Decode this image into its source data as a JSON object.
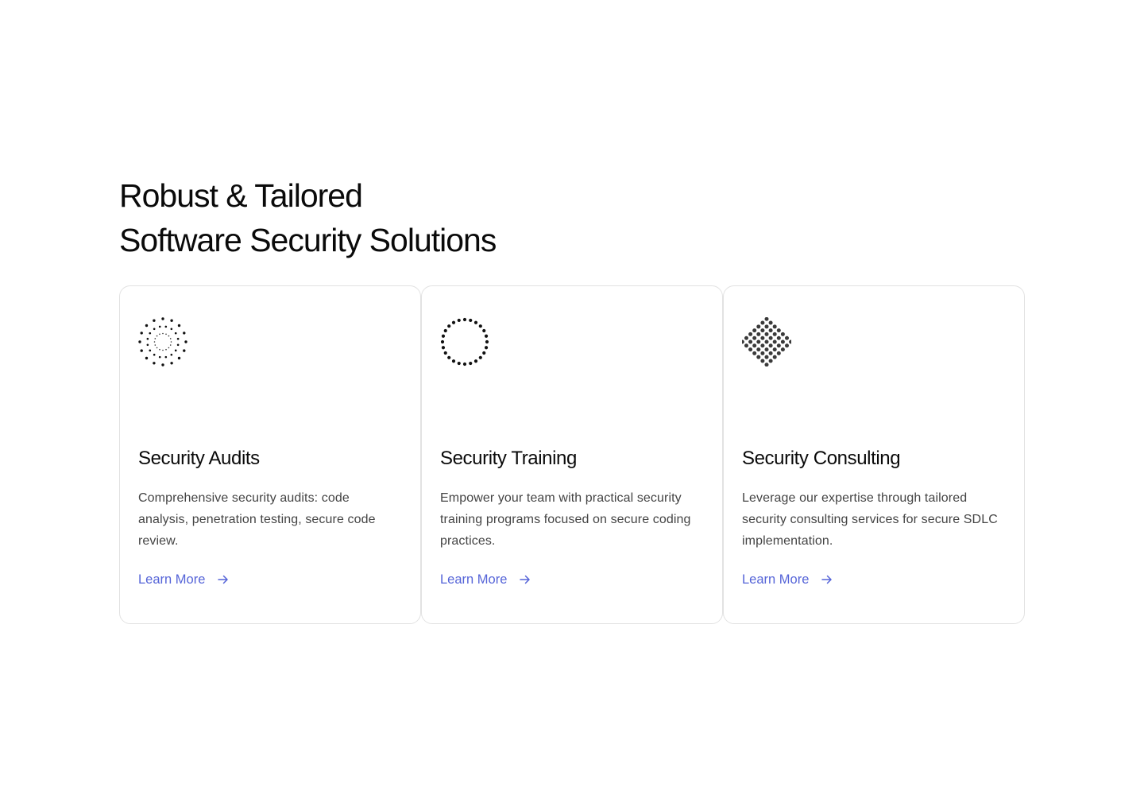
{
  "section": {
    "heading_line1": "Robust & Tailored",
    "heading_line2": "Software Security Solutions"
  },
  "cards": [
    {
      "title": "Security Audits",
      "description": "Comprehensive security audits: code analysis, penetration testing, secure code review.",
      "link_label": "Learn More",
      "icon": "dotted-rings-icon"
    },
    {
      "title": "Security Training",
      "description": "Empower your team with practical security training programs focused on secure coding practices.",
      "link_label": "Learn More",
      "icon": "dotted-circle-icon"
    },
    {
      "title": "Security Consulting",
      "description": "Leverage our expertise through tailored security consulting services for secure SDLC implementation.",
      "link_label": "Learn More",
      "icon": "dot-diamond-icon"
    }
  ],
  "colors": {
    "link": "#5564d8",
    "heading": "#0a0a0a",
    "body_text": "#444444",
    "card_border": "#e2e2e2"
  }
}
